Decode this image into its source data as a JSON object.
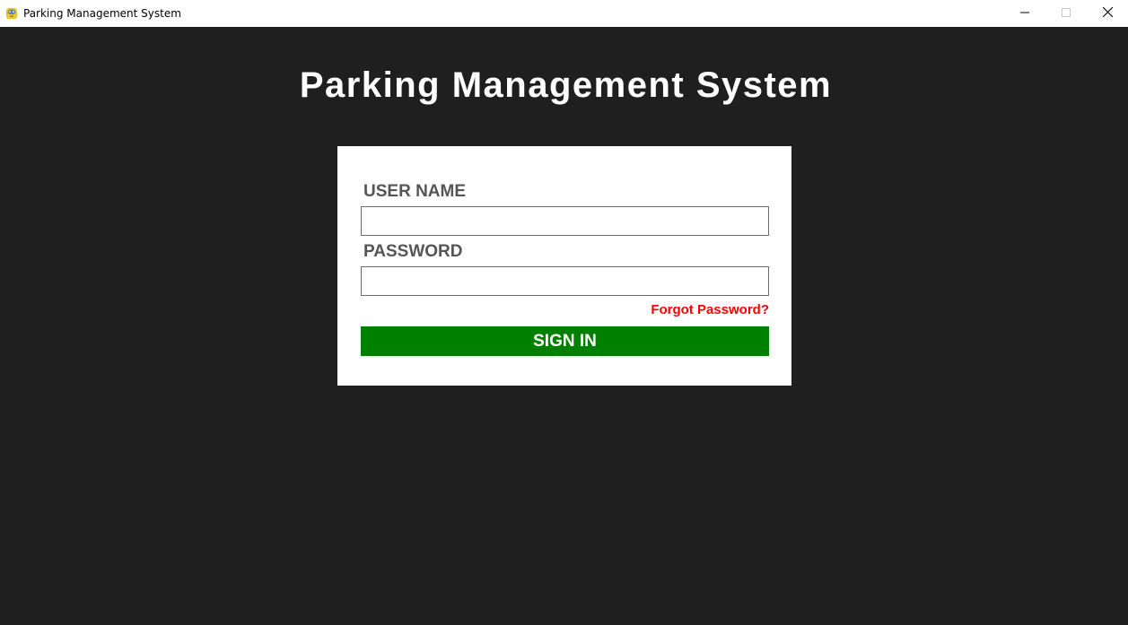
{
  "window": {
    "title": "Parking Management System",
    "icon": "python-snake-icon",
    "controls": [
      "minimize-icon",
      "maximize-icon",
      "close-icon"
    ]
  },
  "page": {
    "heading": "Parking Management System",
    "background_color": "#1f1f1f"
  },
  "login_form": {
    "username_label": "USER NAME",
    "username_value": "",
    "password_label": "PASSWORD",
    "password_value": "",
    "forgot_password": "Forgot Password?",
    "sign_in": "SIGN IN",
    "card_color": "#ffffff",
    "label_color": "#555555",
    "forgot_color": "#ff0000",
    "sign_in_color": "#008000"
  }
}
